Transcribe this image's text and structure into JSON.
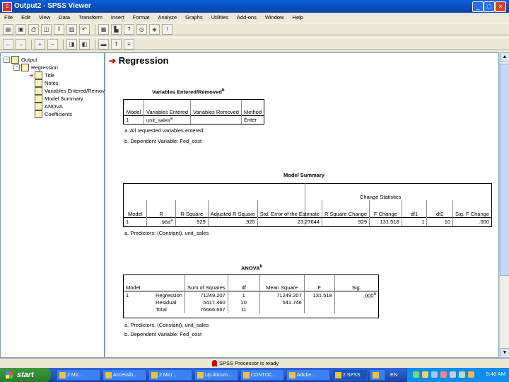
{
  "window": {
    "title": "Output2 - SPSS Viewer",
    "icon": "spss-doc-icon"
  },
  "menu": [
    "File",
    "Edit",
    "View",
    "Data",
    "Transform",
    "Insert",
    "Format",
    "Analyze",
    "Graphs",
    "Utilities",
    "Add-ons",
    "Window",
    "Help"
  ],
  "tree": {
    "root": "Output",
    "group": "Regression",
    "items": [
      "Title",
      "Notes",
      "Variables Entered/Removed",
      "Model Summary",
      "ANOVA",
      "Coefficients"
    ]
  },
  "heading": "Regression",
  "vars_table": {
    "title": "Variables Entered/Removed",
    "title_sup": "b",
    "headers": [
      "Model",
      "Variables Entered",
      "Variables Removed",
      "Method"
    ],
    "row": [
      "1",
      "unit_sales",
      "",
      "Enter"
    ],
    "row_sup": "a",
    "footnotes": [
      "a. All requested variables entered.",
      "b. Dependent Variable: Fed_cost"
    ]
  },
  "model_summary": {
    "title": "Model Summary",
    "group_header": "Change Statistics",
    "headers": [
      "Model",
      "R",
      "R Square",
      "Adjusted R Square",
      "Std. Error of the Estimate",
      "R Square Change",
      "F Change",
      "df1",
      "df2",
      "Sig. F Change"
    ],
    "row": [
      "1",
      ".964",
      "929",
      ".925",
      "23.27644",
      "929",
      "131.518",
      "1",
      "10",
      ".000"
    ],
    "row_sup": "a",
    "footnote": "a. Predictors: (Constant), unit_sales"
  },
  "anova": {
    "title": "ANOVA",
    "title_sup": "b",
    "headers": [
      "Model",
      "",
      "Sum of Squares",
      "df",
      "Mean Square",
      "F",
      "Sig."
    ],
    "rows": [
      [
        "1",
        "Regression",
        "71249.207",
        "1",
        "71249.207",
        "131.518",
        ".000"
      ],
      [
        "",
        "Residual",
        "5417.460",
        "10",
        "541.746",
        "",
        ""
      ],
      [
        "",
        "Total",
        "76666.667",
        "11",
        "",
        "",
        ""
      ]
    ],
    "sig_sup": "a",
    "footnotes": [
      "a. Predictors: (Constant), unit_sales",
      "b. Dependent Variable: Fed_cost"
    ]
  },
  "status": "SPSS Processor is ready",
  "taskbar": {
    "start": "start",
    "tasks": [
      "2 Mic...",
      "Accessib...",
      "2 Micr...",
      "Up.docum...",
      "CONTOC...",
      "Adobe ...",
      "2 SPSS",
      ""
    ],
    "lang": "EN",
    "clock": "5:46 AM"
  }
}
